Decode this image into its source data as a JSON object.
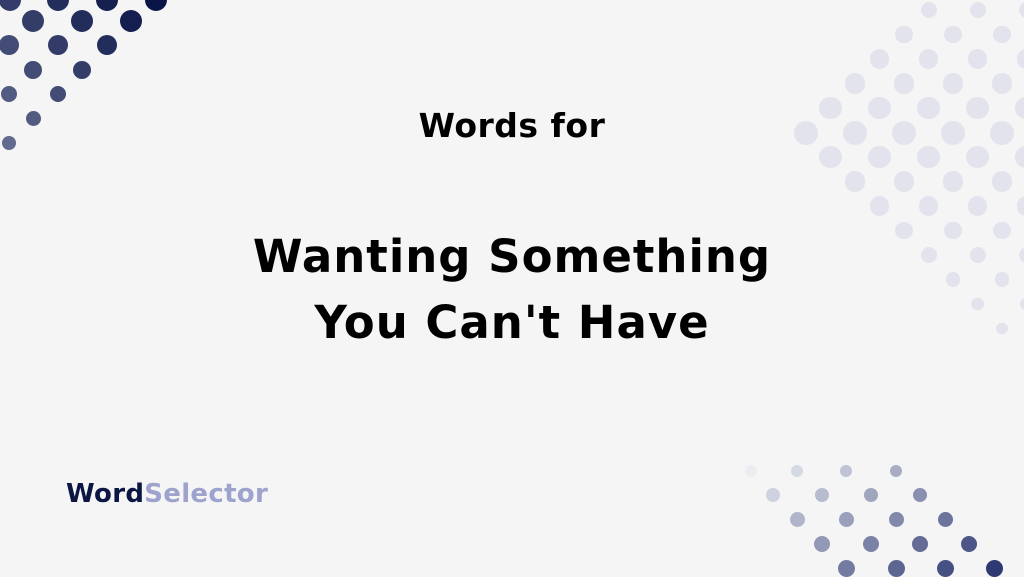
{
  "header": {
    "subtitle": "Words for"
  },
  "main": {
    "title_line1": "Wanting Something",
    "title_line2": "You Can't Have"
  },
  "brand": {
    "part1": "Word",
    "part2": "Selector"
  },
  "colors": {
    "background": "#f5f5f5",
    "brand_dark": "#0b1742",
    "brand_light": "#9da3cc",
    "text": "#000000"
  }
}
